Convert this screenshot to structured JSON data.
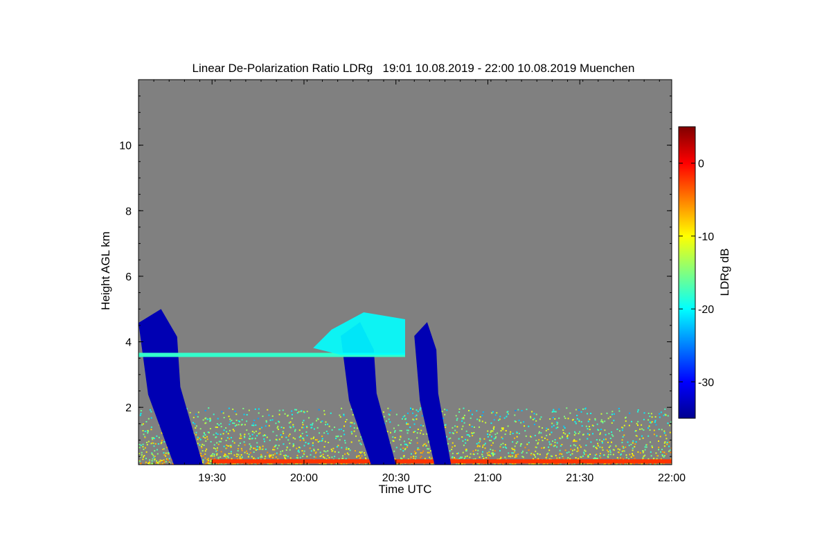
{
  "chart_data": {
    "type": "heatmap",
    "title": "Linear De-Polarization Ratio LDRg   19:01 10.08.2019 - 22:00 10.08.2019 Muenchen",
    "xlabel": "Time UTC",
    "ylabel": "Height AGL km",
    "x_ticks": [
      "19:30",
      "20:00",
      "20:30",
      "21:00",
      "21:30",
      "22:00"
    ],
    "x_tick_hours": [
      19.5,
      20.0,
      20.5,
      21.0,
      21.5,
      22.0
    ],
    "xlim_hours": [
      19.1,
      22.0
    ],
    "y_ticks": [
      "2",
      "4",
      "6",
      "8",
      "10"
    ],
    "y_tick_values": [
      2,
      4,
      6,
      8,
      10
    ],
    "ylim_km": [
      0.25,
      12.0
    ],
    "background_color": "#808080",
    "colorbar": {
      "label": "LDRg dB",
      "ticks": [
        "0",
        "-10",
        "-20",
        "-30"
      ],
      "tick_values": [
        0,
        -10,
        -20,
        -30
      ],
      "range_db": [
        -35,
        5
      ],
      "colormap": "jet"
    },
    "features": [
      {
        "name": "low-level aerosol / noise layer",
        "t_start": 19.1,
        "t_end": 22.0,
        "h_bottom": 0.25,
        "h_top": 2.0,
        "ldr_db": -10
      },
      {
        "name": "near-surface high-LDR line",
        "t_start": 19.5,
        "t_end": 22.0,
        "h": 0.35,
        "ldr_db": -2
      },
      {
        "name": "precipitation column 1",
        "t_start": 19.1,
        "t_end": 19.45,
        "h_bottom": 0.25,
        "h_top": 5.0,
        "ldr_db": -33
      },
      {
        "name": "precipitation column 2",
        "t_start": 20.2,
        "t_end": 20.5,
        "h_bottom": 0.25,
        "h_top": 4.6,
        "ldr_db": -33
      },
      {
        "name": "precipitation column 3",
        "t_start": 20.6,
        "t_end": 20.8,
        "h_bottom": 0.25,
        "h_top": 4.6,
        "ldr_db": -33
      },
      {
        "name": "melting layer",
        "t_start": 19.1,
        "t_end": 20.55,
        "h": 3.6,
        "ldr_db": -18
      },
      {
        "name": "ice cloud top",
        "t_start": 20.05,
        "t_end": 20.55,
        "h_bottom": 3.6,
        "h_top": 4.9,
        "ldr_db": -20
      }
    ]
  }
}
